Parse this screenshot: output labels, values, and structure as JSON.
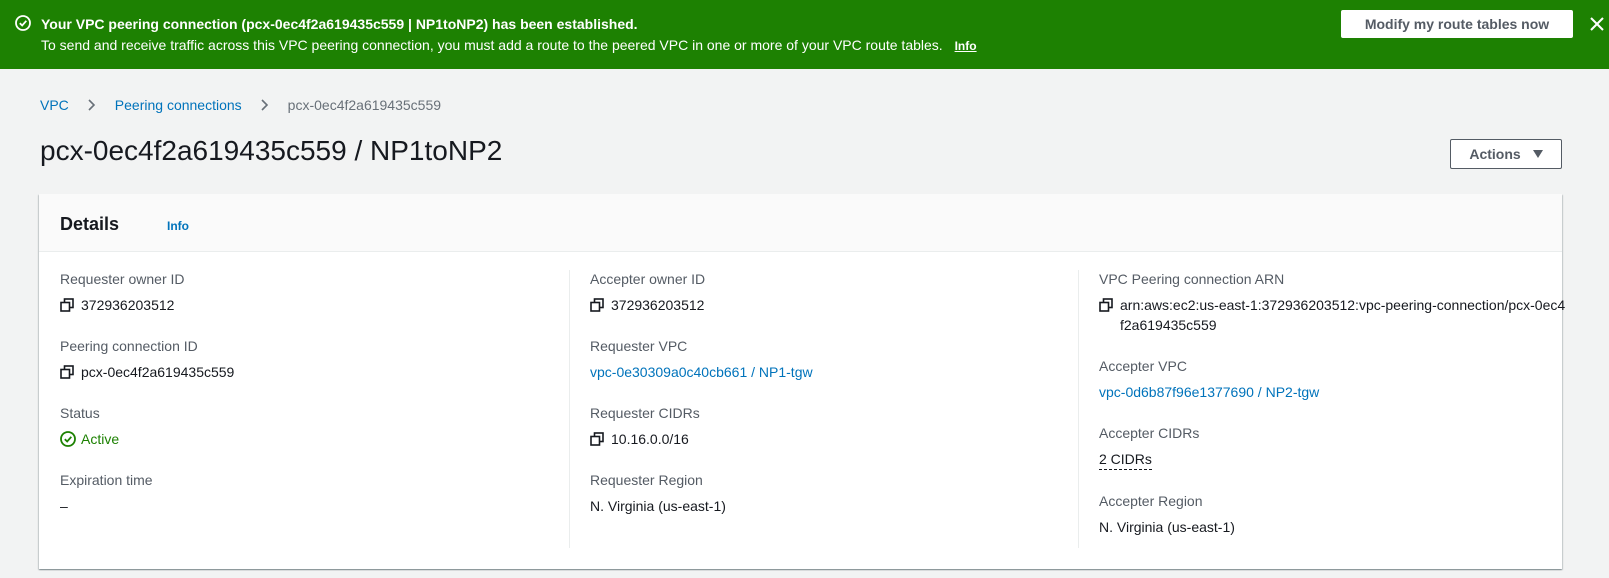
{
  "flash": {
    "title": "Your VPC peering connection (pcx-0ec4f2a619435c559 | NP1toNP2) has been established.",
    "description": "To send and receive traffic across this VPC peering connection, you must add a route to the peered VPC in one or more of your VPC route tables.",
    "info_link": "Info",
    "button_label": "Modify my route tables now",
    "color": "#1d8102"
  },
  "breadcrumb": {
    "items": [
      "VPC",
      "Peering connections"
    ],
    "current": "pcx-0ec4f2a619435c559"
  },
  "page_title": "pcx-0ec4f2a619435c559 / NP1toNP2",
  "actions_label": "Actions",
  "details": {
    "heading": "Details",
    "info_link": "Info",
    "requester_owner_id": {
      "label": "Requester owner ID",
      "value": "372936203512"
    },
    "peering_connection_id": {
      "label": "Peering connection ID",
      "value": "pcx-0ec4f2a619435c559"
    },
    "status": {
      "label": "Status",
      "value": "Active",
      "color": "#1d8102"
    },
    "expiration_time": {
      "label": "Expiration time",
      "value": "–"
    },
    "accepter_owner_id": {
      "label": "Accepter owner ID",
      "value": "372936203512"
    },
    "requester_vpc": {
      "label": "Requester VPC",
      "value": "vpc-0e30309a0c40cb661 / NP1-tgw"
    },
    "requester_cidrs": {
      "label": "Requester CIDRs",
      "value": "10.16.0.0/16"
    },
    "requester_region": {
      "label": "Requester Region",
      "value": "N. Virginia (us-east-1)"
    },
    "arn": {
      "label": "VPC Peering connection ARN",
      "value": "arn:aws:ec2:us-east-1:372936203512:vpc-peering-connection/pcx-0ec4f2a619435c559"
    },
    "accepter_vpc": {
      "label": "Accepter VPC",
      "value": "vpc-0d6b87f96e1377690 / NP2-tgw"
    },
    "accepter_cidrs": {
      "label": "Accepter CIDRs",
      "value": "2 CIDRs"
    },
    "accepter_region": {
      "label": "Accepter Region",
      "value": "N. Virginia (us-east-1)"
    }
  },
  "link_color": "#0073bb"
}
